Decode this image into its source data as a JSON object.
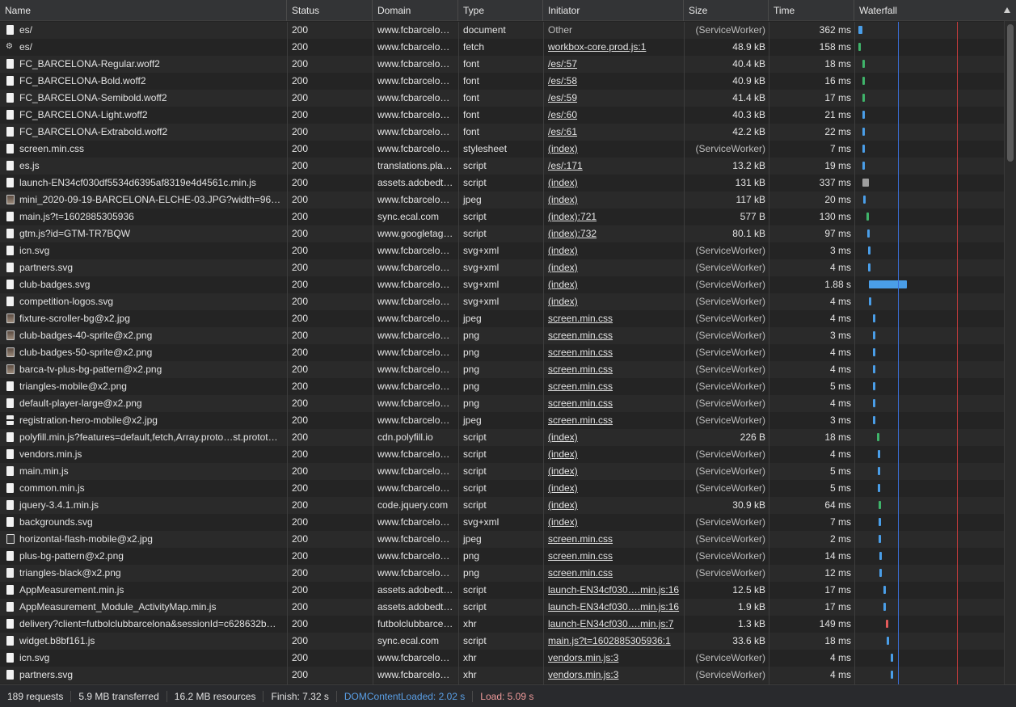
{
  "columns": {
    "name": "Name",
    "status": "Status",
    "domain": "Domain",
    "type": "Type",
    "initiator": "Initiator",
    "size": "Size",
    "time": "Time",
    "waterfall": "Waterfall"
  },
  "rows": [
    {
      "icon": "doc",
      "name": "es/",
      "status": "200",
      "domain": "www.fcbarcelo…",
      "type": "document",
      "initiator": "Other",
      "initiator_link": false,
      "size": "(ServiceWorker)",
      "time": "362 ms",
      "bar": {
        "start": 0.02,
        "width": 0.028,
        "color": "#4a9ee8"
      }
    },
    {
      "icon": "gear",
      "name": "es/",
      "status": "200",
      "domain": "www.fcbarcelo…",
      "type": "fetch",
      "initiator": "workbox-core.prod.js:1",
      "initiator_link": true,
      "size": "48.9 kB",
      "time": "158 ms",
      "bar": {
        "start": 0.02,
        "width": 0.012,
        "color": "#3fb46a"
      }
    },
    {
      "icon": "doc",
      "name": "FC_BARCELONA-Regular.woff2",
      "status": "200",
      "domain": "www.fcbarcelo…",
      "type": "font",
      "initiator": "/es/:57",
      "initiator_link": true,
      "size": "40.4 kB",
      "time": "18 ms",
      "bar": {
        "start": 0.048,
        "width": 0.006,
        "color": "#3fb46a"
      }
    },
    {
      "icon": "doc",
      "name": "FC_BARCELONA-Bold.woff2",
      "status": "200",
      "domain": "www.fcbarcelo…",
      "type": "font",
      "initiator": "/es/:58",
      "initiator_link": true,
      "size": "40.9 kB",
      "time": "16 ms",
      "bar": {
        "start": 0.048,
        "width": 0.006,
        "color": "#3fb46a"
      }
    },
    {
      "icon": "doc",
      "name": "FC_BARCELONA-Semibold.woff2",
      "status": "200",
      "domain": "www.fcbarcelo…",
      "type": "font",
      "initiator": "/es/:59",
      "initiator_link": true,
      "size": "41.4 kB",
      "time": "17 ms",
      "bar": {
        "start": 0.048,
        "width": 0.006,
        "color": "#3fb46a"
      }
    },
    {
      "icon": "doc",
      "name": "FC_BARCELONA-Light.woff2",
      "status": "200",
      "domain": "www.fcbarcelo…",
      "type": "font",
      "initiator": "/es/:60",
      "initiator_link": true,
      "size": "40.3 kB",
      "time": "21 ms",
      "bar": {
        "start": 0.048,
        "width": 0.006,
        "color": "#4a9ee8"
      }
    },
    {
      "icon": "doc",
      "name": "FC_BARCELONA-Extrabold.woff2",
      "status": "200",
      "domain": "www.fcbarcelo…",
      "type": "font",
      "initiator": "/es/:61",
      "initiator_link": true,
      "size": "42.2 kB",
      "time": "22 ms",
      "bar": {
        "start": 0.048,
        "width": 0.006,
        "color": "#4a9ee8"
      }
    },
    {
      "icon": "doc",
      "name": "screen.min.css",
      "status": "200",
      "domain": "www.fcbarcelo…",
      "type": "stylesheet",
      "initiator": "(index)",
      "initiator_link": true,
      "size": "(ServiceWorker)",
      "time": "7 ms",
      "bar": {
        "start": 0.048,
        "width": 0.005,
        "color": "#4a9ee8"
      }
    },
    {
      "icon": "doc",
      "name": "es.js",
      "status": "200",
      "domain": "translations.pla…",
      "type": "script",
      "initiator": "/es/:171",
      "initiator_link": true,
      "size": "13.2 kB",
      "time": "19 ms",
      "bar": {
        "start": 0.05,
        "width": 0.006,
        "color": "#4a9ee8"
      }
    },
    {
      "icon": "doc",
      "name": "launch-EN34cf030df5534d6395af8319e4d4561c.min.js",
      "status": "200",
      "domain": "assets.adobedt…",
      "type": "script",
      "initiator": "(index)",
      "initiator_link": true,
      "size": "131 kB",
      "time": "337 ms",
      "bar": {
        "start": 0.05,
        "width": 0.04,
        "color": "#9e9e9e"
      }
    },
    {
      "icon": "image",
      "name": "mini_2020-09-19-BARCELONA-ELCHE-03.JPG?width=96…",
      "status": "200",
      "domain": "www.fcbarcelo…",
      "type": "jpeg",
      "initiator": "(index)",
      "initiator_link": true,
      "size": "117 kB",
      "time": "20 ms",
      "bar": {
        "start": 0.052,
        "width": 0.006,
        "color": "#4a9ee8"
      }
    },
    {
      "icon": "doc",
      "name": "main.js?t=1602885305936",
      "status": "200",
      "domain": "sync.ecal.com",
      "type": "script",
      "initiator": "(index):721",
      "initiator_link": true,
      "size": "577 B",
      "time": "130 ms",
      "bar": {
        "start": 0.075,
        "width": 0.012,
        "color": "#3fb46a"
      }
    },
    {
      "icon": "doc",
      "name": "gtm.js?id=GTM-TR7BQW",
      "status": "200",
      "domain": "www.googletag…",
      "type": "script",
      "initiator": "(index):732",
      "initiator_link": true,
      "size": "80.1 kB",
      "time": "97 ms",
      "bar": {
        "start": 0.08,
        "width": 0.01,
        "color": "#4a9ee8"
      }
    },
    {
      "icon": "doc",
      "name": "icn.svg",
      "status": "200",
      "domain": "www.fcbarcelo…",
      "type": "svg+xml",
      "initiator": "(index)",
      "initiator_link": true,
      "size": "(ServiceWorker)",
      "time": "3 ms",
      "bar": {
        "start": 0.085,
        "width": 0.005,
        "color": "#4a9ee8"
      }
    },
    {
      "icon": "doc",
      "name": "partners.svg",
      "status": "200",
      "domain": "www.fcbarcelo…",
      "type": "svg+xml",
      "initiator": "(index)",
      "initiator_link": true,
      "size": "(ServiceWorker)",
      "time": "4 ms",
      "bar": {
        "start": 0.088,
        "width": 0.005,
        "color": "#4a9ee8"
      }
    },
    {
      "icon": "doc",
      "name": "club-badges.svg",
      "status": "200",
      "domain": "www.fcbarcelo…",
      "type": "svg+xml",
      "initiator": "(index)",
      "initiator_link": true,
      "size": "(ServiceWorker)",
      "time": "1.88 s",
      "bar": {
        "start": 0.09,
        "width": 0.26,
        "color": "#4a9ee8"
      }
    },
    {
      "icon": "doc",
      "name": "competition-logos.svg",
      "status": "200",
      "domain": "www.fcbarcelo…",
      "type": "svg+xml",
      "initiator": "(index)",
      "initiator_link": true,
      "size": "(ServiceWorker)",
      "time": "4 ms",
      "bar": {
        "start": 0.09,
        "width": 0.005,
        "color": "#4a9ee8"
      }
    },
    {
      "icon": "image",
      "name": "fixture-scroller-bg@x2.jpg",
      "status": "200",
      "domain": "www.fcbarcelo…",
      "type": "jpeg",
      "initiator": "screen.min.css",
      "initiator_link": true,
      "size": "(ServiceWorker)",
      "time": "4 ms",
      "bar": {
        "start": 0.12,
        "width": 0.005,
        "color": "#4a9ee8"
      }
    },
    {
      "icon": "image",
      "name": "club-badges-40-sprite@x2.png",
      "status": "200",
      "domain": "www.fcbarcelo…",
      "type": "png",
      "initiator": "screen.min.css",
      "initiator_link": true,
      "size": "(ServiceWorker)",
      "time": "3 ms",
      "bar": {
        "start": 0.12,
        "width": 0.005,
        "color": "#4a9ee8"
      }
    },
    {
      "icon": "image",
      "name": "club-badges-50-sprite@x2.png",
      "status": "200",
      "domain": "www.fcbarcelo…",
      "type": "png",
      "initiator": "screen.min.css",
      "initiator_link": true,
      "size": "(ServiceWorker)",
      "time": "4 ms",
      "bar": {
        "start": 0.12,
        "width": 0.005,
        "color": "#4a9ee8"
      }
    },
    {
      "icon": "image",
      "name": "barca-tv-plus-bg-pattern@x2.png",
      "status": "200",
      "domain": "www.fcbarcelo…",
      "type": "png",
      "initiator": "screen.min.css",
      "initiator_link": true,
      "size": "(ServiceWorker)",
      "time": "4 ms",
      "bar": {
        "start": 0.12,
        "width": 0.005,
        "color": "#4a9ee8"
      }
    },
    {
      "icon": "doc",
      "name": "triangles-mobile@x2.png",
      "status": "200",
      "domain": "www.fcbarcelo…",
      "type": "png",
      "initiator": "screen.min.css",
      "initiator_link": true,
      "size": "(ServiceWorker)",
      "time": "5 ms",
      "bar": {
        "start": 0.122,
        "width": 0.005,
        "color": "#4a9ee8"
      }
    },
    {
      "icon": "doc",
      "name": "default-player-large@x2.png",
      "status": "200",
      "domain": "www.fcbarcelo…",
      "type": "png",
      "initiator": "screen.min.css",
      "initiator_link": true,
      "size": "(ServiceWorker)",
      "time": "4 ms",
      "bar": {
        "start": 0.122,
        "width": 0.005,
        "color": "#4a9ee8"
      }
    },
    {
      "icon": "stripe",
      "name": "registration-hero-mobile@x2.jpg",
      "status": "200",
      "domain": "www.fcbarcelo…",
      "type": "jpeg",
      "initiator": "screen.min.css",
      "initiator_link": true,
      "size": "(ServiceWorker)",
      "time": "3 ms",
      "bar": {
        "start": 0.122,
        "width": 0.005,
        "color": "#4a9ee8"
      }
    },
    {
      "icon": "doc",
      "name": "polyfill.min.js?features=default,fetch,Array.proto…st.protot…",
      "status": "200",
      "domain": "cdn.polyfill.io",
      "type": "script",
      "initiator": "(index)",
      "initiator_link": true,
      "size": "226 B",
      "time": "18 ms",
      "bar": {
        "start": 0.145,
        "width": 0.007,
        "color": "#3fb46a"
      }
    },
    {
      "icon": "doc",
      "name": "vendors.min.js",
      "status": "200",
      "domain": "www.fcbarcelo…",
      "type": "script",
      "initiator": "(index)",
      "initiator_link": true,
      "size": "(ServiceWorker)",
      "time": "4 ms",
      "bar": {
        "start": 0.15,
        "width": 0.005,
        "color": "#4a9ee8"
      }
    },
    {
      "icon": "doc",
      "name": "main.min.js",
      "status": "200",
      "domain": "www.fcbarcelo…",
      "type": "script",
      "initiator": "(index)",
      "initiator_link": true,
      "size": "(ServiceWorker)",
      "time": "5 ms",
      "bar": {
        "start": 0.15,
        "width": 0.005,
        "color": "#4a9ee8"
      }
    },
    {
      "icon": "doc",
      "name": "common.min.js",
      "status": "200",
      "domain": "www.fcbarcelo…",
      "type": "script",
      "initiator": "(index)",
      "initiator_link": true,
      "size": "(ServiceWorker)",
      "time": "5 ms",
      "bar": {
        "start": 0.15,
        "width": 0.005,
        "color": "#4a9ee8"
      }
    },
    {
      "icon": "doc",
      "name": "jquery-3.4.1.min.js",
      "status": "200",
      "domain": "code.jquery.com",
      "type": "script",
      "initiator": "(index)",
      "initiator_link": true,
      "size": "30.9 kB",
      "time": "64 ms",
      "bar": {
        "start": 0.155,
        "width": 0.01,
        "color": "#3fb46a"
      }
    },
    {
      "icon": "doc",
      "name": "backgrounds.svg",
      "status": "200",
      "domain": "www.fcbarcelo…",
      "type": "svg+xml",
      "initiator": "(index)",
      "initiator_link": true,
      "size": "(ServiceWorker)",
      "time": "7 ms",
      "bar": {
        "start": 0.16,
        "width": 0.005,
        "color": "#4a9ee8"
      }
    },
    {
      "icon": "dark",
      "name": "horizontal-flash-mobile@x2.jpg",
      "status": "200",
      "domain": "www.fcbarcelo…",
      "type": "jpeg",
      "initiator": "screen.min.css",
      "initiator_link": true,
      "size": "(ServiceWorker)",
      "time": "2 ms",
      "bar": {
        "start": 0.16,
        "width": 0.005,
        "color": "#4a9ee8"
      }
    },
    {
      "icon": "doc",
      "name": "plus-bg-pattern@x2.png",
      "status": "200",
      "domain": "www.fcbarcelo…",
      "type": "png",
      "initiator": "screen.min.css",
      "initiator_link": true,
      "size": "(ServiceWorker)",
      "time": "14 ms",
      "bar": {
        "start": 0.162,
        "width": 0.006,
        "color": "#4a9ee8"
      }
    },
    {
      "icon": "excl",
      "name": "triangles-black@x2.png",
      "status": "200",
      "domain": "www.fcbarcelo…",
      "type": "png",
      "initiator": "screen.min.css",
      "initiator_link": true,
      "size": "(ServiceWorker)",
      "time": "12 ms",
      "bar": {
        "start": 0.162,
        "width": 0.006,
        "color": "#4a9ee8"
      }
    },
    {
      "icon": "doc",
      "name": "AppMeasurement.min.js",
      "status": "200",
      "domain": "assets.adobedt…",
      "type": "script",
      "initiator": "launch-EN34cf030….min.js:16",
      "initiator_link": true,
      "size": "12.5 kB",
      "time": "17 ms",
      "bar": {
        "start": 0.19,
        "width": 0.006,
        "color": "#4a9ee8"
      }
    },
    {
      "icon": "doc",
      "name": "AppMeasurement_Module_ActivityMap.min.js",
      "status": "200",
      "domain": "assets.adobedt…",
      "type": "script",
      "initiator": "launch-EN34cf030….min.js:16",
      "initiator_link": true,
      "size": "1.9 kB",
      "time": "17 ms",
      "bar": {
        "start": 0.19,
        "width": 0.006,
        "color": "#4a9ee8"
      }
    },
    {
      "icon": "doc",
      "name": "delivery?client=futbolclubbarcelona&sessionId=c628632b…",
      "status": "200",
      "domain": "futbolclubbarce…",
      "type": "xhr",
      "initiator": "launch-EN34cf030….min.js:7",
      "initiator_link": true,
      "size": "1.3 kB",
      "time": "149 ms",
      "bar": {
        "start": 0.205,
        "width": 0.015,
        "color": "#e35a5a"
      }
    },
    {
      "icon": "doc",
      "name": "widget.b8bf161.js",
      "status": "200",
      "domain": "sync.ecal.com",
      "type": "script",
      "initiator": "main.js?t=1602885305936:1",
      "initiator_link": true,
      "size": "33.6 kB",
      "time": "18 ms",
      "bar": {
        "start": 0.21,
        "width": 0.008,
        "color": "#4a9ee8"
      }
    },
    {
      "icon": "doc",
      "name": "icn.svg",
      "status": "200",
      "domain": "www.fcbarcelo…",
      "type": "xhr",
      "initiator": "vendors.min.js:3",
      "initiator_link": true,
      "size": "(ServiceWorker)",
      "time": "4 ms",
      "bar": {
        "start": 0.24,
        "width": 0.006,
        "color": "#4a9ee8"
      }
    },
    {
      "icon": "doc",
      "name": "partners.svg",
      "status": "200",
      "domain": "www.fcbarcelo…",
      "type": "xhr",
      "initiator": "vendors.min.js:3",
      "initiator_link": true,
      "size": "(ServiceWorker)",
      "time": "4 ms",
      "bar": {
        "start": 0.24,
        "width": 0.006,
        "color": "#4a9ee8"
      }
    }
  ],
  "waterfall_markers": {
    "dom_content_loaded_color": "#3a6fd8",
    "load_color": "#c23b3b"
  },
  "status_bar": {
    "requests": "189 requests",
    "transferred": "5.9 MB transferred",
    "resources": "16.2 MB resources",
    "finish": "Finish: 7.32 s",
    "dom_content_loaded": "DOMContentLoaded: 2.02 s",
    "load": "Load: 5.09 s"
  }
}
